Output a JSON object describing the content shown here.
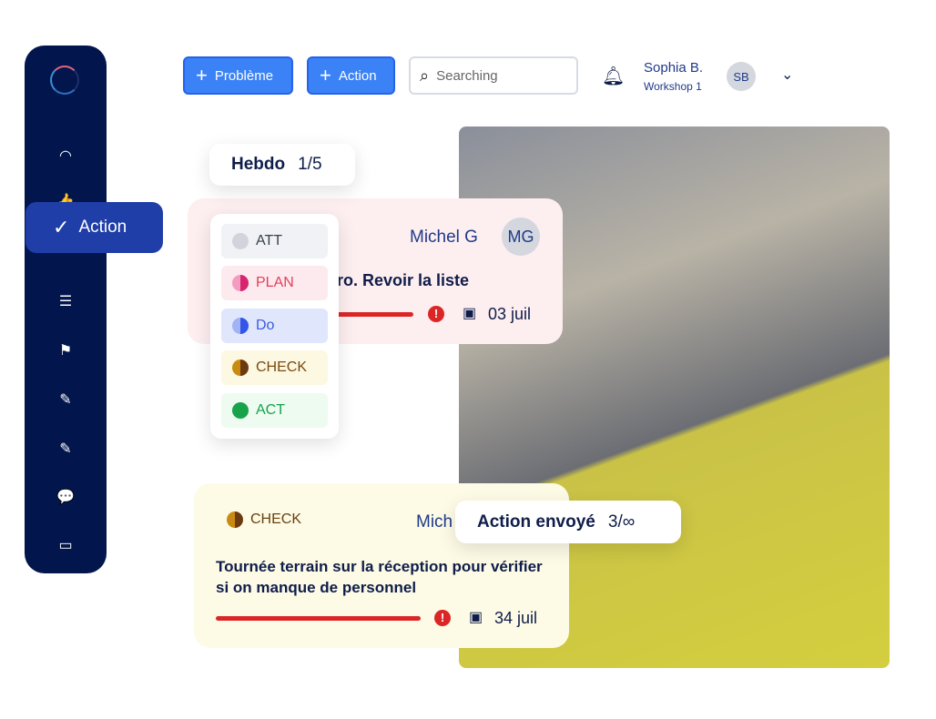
{
  "sidebar": {
    "active_label": "Action",
    "icons": [
      "gauge-icon",
      "thumbs-up-icon",
      "check-icon",
      "menu-icon",
      "flag-icon",
      "edit-icon",
      "edit-icon",
      "chat-icon",
      "calendar-icon"
    ]
  },
  "toolbar": {
    "probleme_label": "Problème",
    "action_label": "Action",
    "search_placeholder": "Searching"
  },
  "user": {
    "name": "Sophia B.",
    "workshop": "Workshop 1",
    "initials": "SB"
  },
  "hebdo": {
    "label": "Hebdo",
    "count": "1/5"
  },
  "card1": {
    "assignee": "Michel G",
    "initials": "MG",
    "title": "ro. Revoir la liste",
    "date": "03 juil",
    "color": "#fdeef0"
  },
  "status_menu": [
    {
      "label": "ATT",
      "color": "#374151",
      "bg": "#f1f2f5"
    },
    {
      "label": "PLAN",
      "color": "#e0405a",
      "bg": "#fdeaee"
    },
    {
      "label": "Do",
      "color": "#3b5bdb",
      "bg": "#e0e7fd"
    },
    {
      "label": "CHECK",
      "color": "#7a4a10",
      "bg": "#fdf8e2"
    },
    {
      "label": "ACT",
      "color": "#16a34a",
      "bg": "#edfbf1"
    }
  ],
  "card2": {
    "status": "CHECK",
    "assignee": "Mich",
    "title": "Tournée terrain sur la réception pour vérifier si on manque de personnel",
    "date": "34 juil",
    "color": "#fdfbe6"
  },
  "sent": {
    "label": "Action envoyé",
    "count": "3/∞"
  }
}
